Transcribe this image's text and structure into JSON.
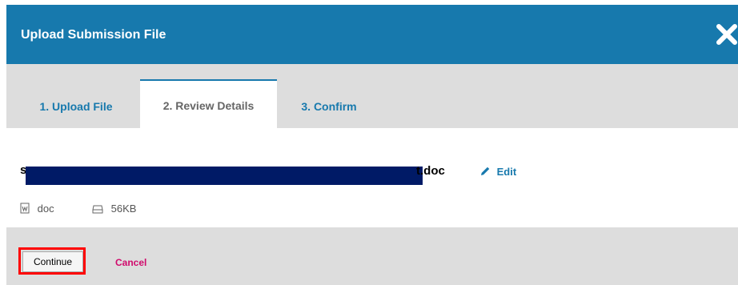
{
  "modal": {
    "title": "Upload Submission File",
    "close_icon": "close-icon"
  },
  "tabs": [
    {
      "label": "1. Upload File"
    },
    {
      "label": "2. Review Details",
      "active": true
    },
    {
      "label": "3. Confirm"
    }
  ],
  "file": {
    "name_visible_suffix": "t.doc",
    "edit_label": "Edit",
    "type": "doc",
    "size": "56KB",
    "icons": {
      "type": "word-file-icon",
      "size": "drive-icon",
      "edit": "pencil-icon"
    }
  },
  "footer": {
    "continue_label": "Continue",
    "cancel_label": "Cancel"
  },
  "colors": {
    "header": "#1779ad",
    "tab_active_text": "#666666",
    "link": "#1779ad",
    "cancel": "#d00a6c",
    "highlight": "#ff0000"
  }
}
